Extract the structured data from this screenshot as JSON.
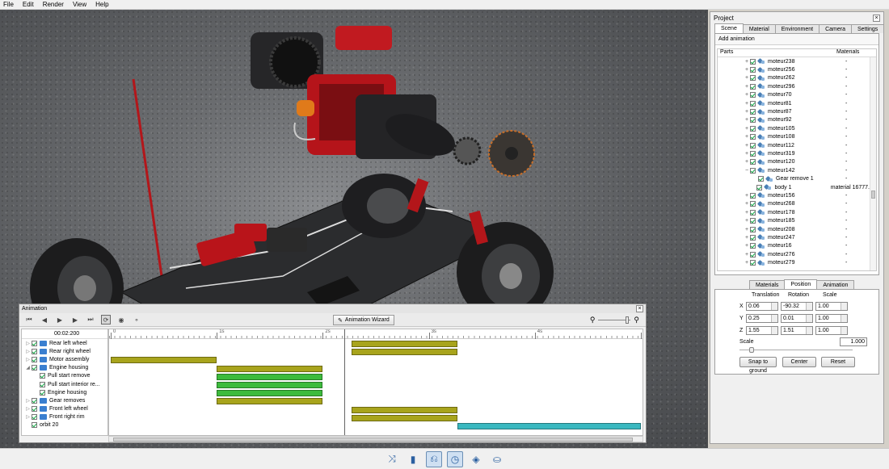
{
  "menu": [
    "File",
    "Edit",
    "Render",
    "View",
    "Help"
  ],
  "project": {
    "title": "Project",
    "tabs": [
      "Scene",
      "Material",
      "Environment",
      "Camera",
      "Settings"
    ],
    "add_animation": "Add animation",
    "columns": [
      "Parts",
      "Materials"
    ],
    "rows": [
      {
        "exp": "+",
        "name": "moteur238",
        "mat": "-",
        "indent": 0
      },
      {
        "exp": "+",
        "name": "moteur256",
        "mat": "-",
        "indent": 0
      },
      {
        "exp": "+",
        "name": "moteur262",
        "mat": "-",
        "indent": 0
      },
      {
        "exp": "+",
        "name": "moteur296",
        "mat": "-",
        "indent": 0
      },
      {
        "exp": "+",
        "name": "moteur70",
        "mat": "-",
        "indent": 0
      },
      {
        "exp": "+",
        "name": "moteur81",
        "mat": "-",
        "indent": 0
      },
      {
        "exp": "+",
        "name": "moteur87",
        "mat": "-",
        "indent": 0
      },
      {
        "exp": "+",
        "name": "moteur92",
        "mat": "-",
        "indent": 0
      },
      {
        "exp": "+",
        "name": "moteur105",
        "mat": "-",
        "indent": 0
      },
      {
        "exp": "+",
        "name": "moteur108",
        "mat": "-",
        "indent": 0
      },
      {
        "exp": "+",
        "name": "moteur112",
        "mat": "-",
        "indent": 0
      },
      {
        "exp": "+",
        "name": "moteur319",
        "mat": "-",
        "indent": 0
      },
      {
        "exp": "+",
        "name": "moteur120",
        "mat": "-",
        "indent": 0
      },
      {
        "exp": "−",
        "name": "moteur142",
        "mat": "-",
        "indent": 0
      },
      {
        "exp": "",
        "name": "Gear remove 1",
        "mat": "-",
        "indent": 1
      },
      {
        "exp": "",
        "name": "body 1",
        "mat": "material 16777.",
        "indent": 1
      },
      {
        "exp": "+",
        "name": "moteur156",
        "mat": "-",
        "indent": 0
      },
      {
        "exp": "+",
        "name": "moteur268",
        "mat": "-",
        "indent": 0
      },
      {
        "exp": "+",
        "name": "moteur178",
        "mat": "-",
        "indent": 0
      },
      {
        "exp": "+",
        "name": "moteur185",
        "mat": "-",
        "indent": 0
      },
      {
        "exp": "+",
        "name": "moteur208",
        "mat": "-",
        "indent": 0
      },
      {
        "exp": "+",
        "name": "moteur247",
        "mat": "-",
        "indent": 0
      },
      {
        "exp": "+",
        "name": "moteur16",
        "mat": "-",
        "indent": 0
      },
      {
        "exp": "+",
        "name": "moteur276",
        "mat": "-",
        "indent": 0
      },
      {
        "exp": "+",
        "name": "moteur279",
        "mat": "-",
        "indent": 0
      }
    ],
    "lower_tabs": [
      "Materials",
      "Position",
      "Animation"
    ],
    "position": {
      "headers": [
        "Translation",
        "Rotation",
        "Scale"
      ],
      "x": {
        "label": "X",
        "translation": "0.06",
        "rotation": "-90.32",
        "scale": "1.00"
      },
      "y": {
        "label": "Y",
        "translation": "0.25",
        "rotation": "0.01",
        "scale": "1.00"
      },
      "z": {
        "label": "Z",
        "translation": "1.55",
        "rotation": "1.51",
        "scale": "1.00"
      },
      "scale_label": "Scale",
      "scale_value": "1.000",
      "snap": "Snap to ground",
      "center": "Center",
      "reset": "Reset"
    }
  },
  "animation": {
    "title": "Animation",
    "wizard": "Animation Wizard",
    "time": "00:02:200",
    "ruler": [
      "0",
      "1s",
      "2s",
      "3s",
      "4s",
      "5s"
    ],
    "tracks": [
      {
        "name": "Rear left wheel",
        "exp": "▷",
        "folder": true,
        "indent": 0
      },
      {
        "name": "Rear right wheel",
        "exp": "▷",
        "folder": true,
        "indent": 0
      },
      {
        "name": "Motor assembly",
        "exp": "▷",
        "folder": true,
        "indent": 0
      },
      {
        "name": "Engine housing",
        "exp": "◢",
        "folder": true,
        "indent": 0
      },
      {
        "name": "Pull start remove",
        "exp": "",
        "folder": false,
        "indent": 1
      },
      {
        "name": "Pull start interior re...",
        "exp": "",
        "folder": false,
        "indent": 1
      },
      {
        "name": "Engine housing",
        "exp": "",
        "folder": false,
        "indent": 1
      },
      {
        "name": "Gear removes",
        "exp": "▷",
        "folder": true,
        "indent": 0
      },
      {
        "name": "Front left wheel",
        "exp": "▷",
        "folder": true,
        "indent": 0
      },
      {
        "name": "Front right rim",
        "exp": "▷",
        "folder": true,
        "indent": 0
      },
      {
        "name": "orbit 20",
        "exp": "",
        "folder": false,
        "indent": 0
      }
    ],
    "bars": [
      {
        "row": 0,
        "start": 2.27,
        "end": 3.27,
        "color": "#a8a41c"
      },
      {
        "row": 1,
        "start": 2.27,
        "end": 3.27,
        "color": "#a8a41c"
      },
      {
        "row": 2,
        "start": 0.0,
        "end": 1.0,
        "color": "#a8a41c"
      },
      {
        "row": 3,
        "start": 1.0,
        "end": 2.0,
        "color": "#a8a41c"
      },
      {
        "row": 4,
        "start": 1.0,
        "end": 2.0,
        "color": "#3dbb3d"
      },
      {
        "row": 5,
        "start": 1.0,
        "end": 2.0,
        "color": "#3dbb3d"
      },
      {
        "row": 6,
        "start": 1.0,
        "end": 2.0,
        "color": "#3dbb3d"
      },
      {
        "row": 7,
        "start": 1.0,
        "end": 2.0,
        "color": "#a8a41c"
      },
      {
        "row": 8,
        "start": 2.27,
        "end": 3.27,
        "color": "#a8a41c"
      },
      {
        "row": 9,
        "start": 2.27,
        "end": 3.27,
        "color": "#a8a41c"
      },
      {
        "row": 10,
        "start": 3.27,
        "end": 5.0,
        "color": "#3ab8c0"
      }
    ],
    "playhead_time": 2.2,
    "duration": 5.0
  },
  "bottom_tools": [
    "camera-path-icon",
    "cube-icon",
    "animation-icon",
    "timer-icon",
    "tag-icon",
    "teapot-icon"
  ]
}
